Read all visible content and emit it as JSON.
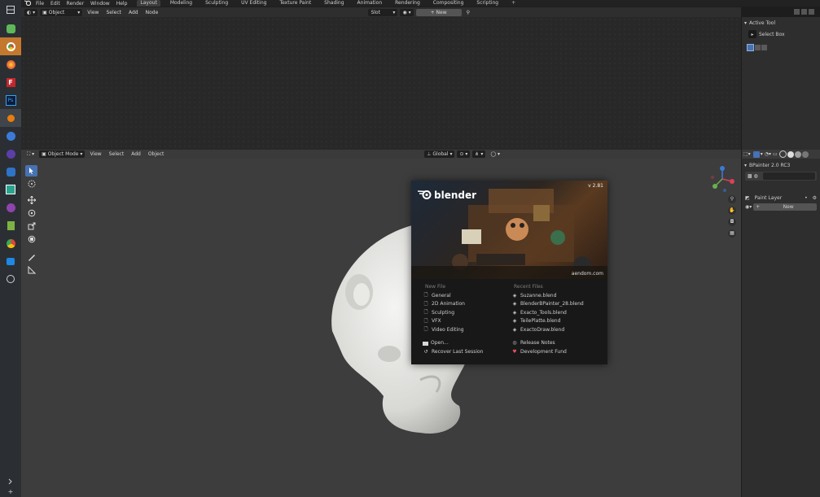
{
  "menubar": {
    "items": [
      "File",
      "Edit",
      "Render",
      "Window",
      "Help"
    ],
    "workspaces": [
      "Layout",
      "Modeling",
      "Sculpting",
      "UV Editing",
      "Texture Paint",
      "Shading",
      "Animation",
      "Rendering",
      "Compositing",
      "Scripting"
    ],
    "active_workspace": "Layout"
  },
  "node_editor": {
    "object_selector": "Object",
    "menus": [
      "View",
      "Select",
      "Add",
      "Node"
    ],
    "slot_label": "Slot",
    "new_label": "New"
  },
  "active_tool_panel": {
    "title": "Active Tool",
    "tool_name": "Select Box"
  },
  "viewport": {
    "mode": "Object Mode",
    "menus": [
      "View",
      "Select",
      "Add",
      "Object"
    ],
    "transform_orientation": "Global"
  },
  "properties_panel": {
    "addon_title": "BPainter 2.0 RC3",
    "layer_label": "Paint Layer",
    "new_label": "New"
  },
  "splash": {
    "logo": "blender",
    "version": "v 2.81",
    "credit": "aendom.com",
    "new_file_title": "New File",
    "new_file_items": [
      "General",
      "2D Animation",
      "Sculpting",
      "VFX",
      "Video Editing"
    ],
    "recent_title": "Recent Files",
    "recent_items": [
      "Suzanne.blend",
      "BlenderBPainter_28.blend",
      "Exacto_Tools.blend",
      "TeilePlatte.blend",
      "ExactoDraw.blend"
    ],
    "open_label": "Open...",
    "recover_label": "Recover Last Session",
    "release_notes_label": "Release Notes",
    "dev_fund_label": "Development Fund"
  },
  "colors": {
    "accent_blue": "#4772b3",
    "active_orange": "#e08a2e",
    "heart_red": "#e05060"
  }
}
